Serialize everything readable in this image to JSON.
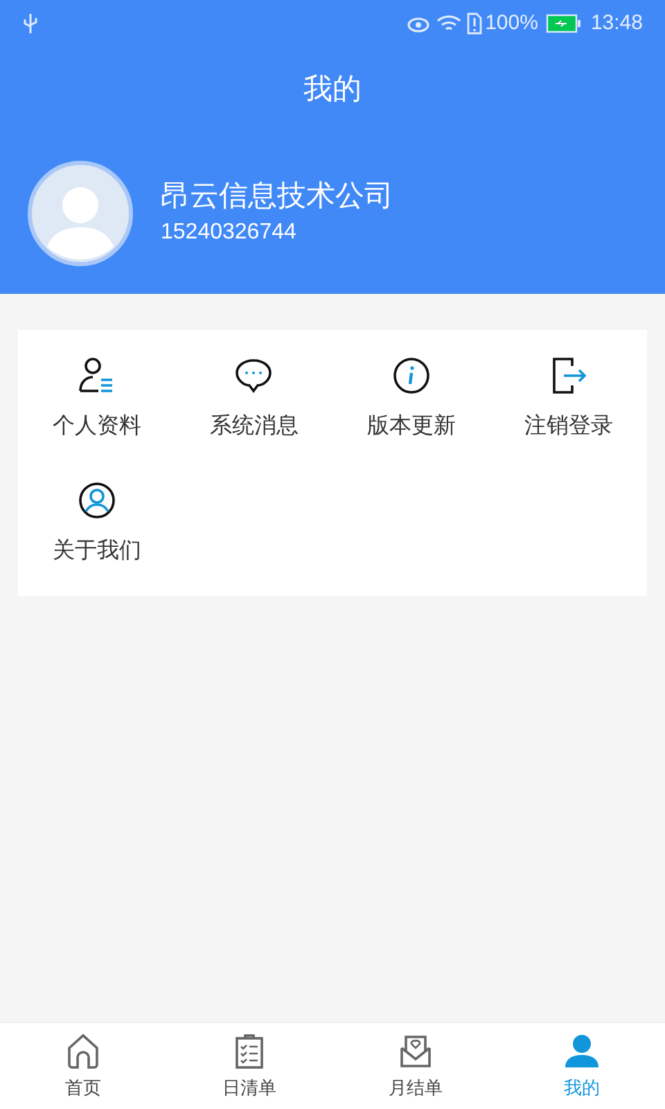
{
  "status_bar": {
    "battery": "100%",
    "time": "13:48"
  },
  "header": {
    "title": "我的"
  },
  "profile": {
    "name": "昂云信息技术公司",
    "phone": "15240326744"
  },
  "menu": [
    {
      "label": "个人资料"
    },
    {
      "label": "系统消息"
    },
    {
      "label": "版本更新"
    },
    {
      "label": "注销登录"
    },
    {
      "label": "关于我们"
    }
  ],
  "tabs": [
    {
      "label": "首页",
      "selected": false
    },
    {
      "label": "日清单",
      "selected": false
    },
    {
      "label": "月结单",
      "selected": false
    },
    {
      "label": "我的",
      "selected": true
    }
  ]
}
